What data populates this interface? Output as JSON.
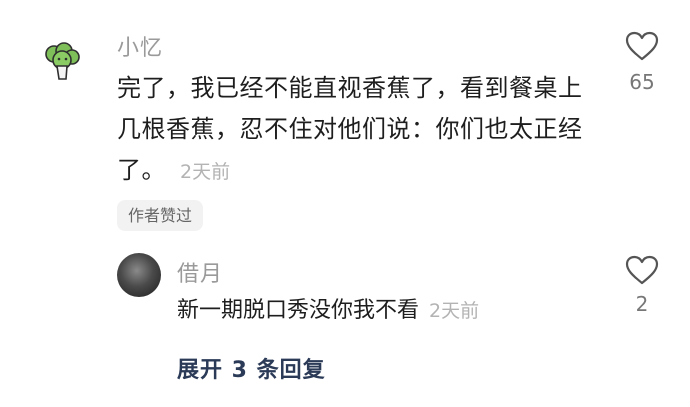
{
  "comment": {
    "username": "小忆",
    "text": "完了，我已经不能直视香蕉了，看到餐桌上几根香蕉，忍不住对他们说：你们也太正经了。",
    "time": "2天前",
    "like_count": "65",
    "author_liked_badge": "作者赞过",
    "avatar_icon": "broccoli-icon"
  },
  "reply": {
    "username": "借月",
    "text": "新一期脱口秀没你我不看",
    "time": "2天前",
    "like_count": "2"
  },
  "expand": {
    "label": "展开 3 条回复"
  },
  "colors": {
    "avatar_green": "#6aa84f",
    "link_blue": "#2a3a57"
  }
}
